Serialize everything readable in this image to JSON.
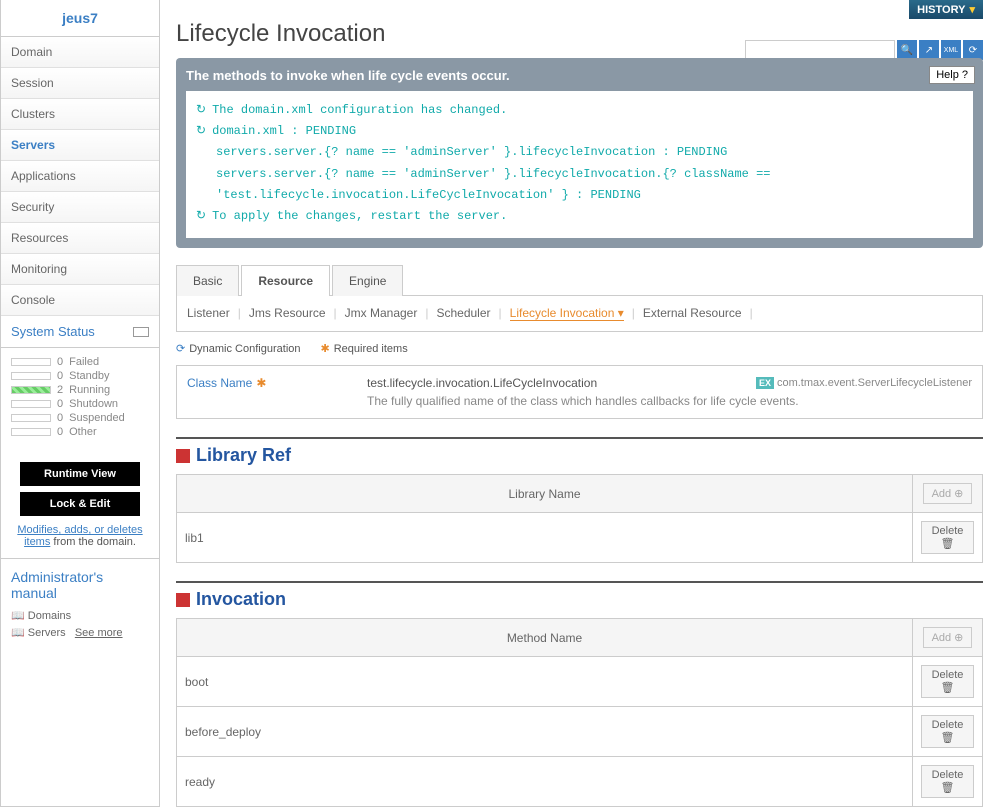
{
  "brand": "jeus7",
  "nav": [
    "Domain",
    "Session",
    "Clusters",
    "Servers",
    "Applications",
    "Security",
    "Resources",
    "Monitoring",
    "Console"
  ],
  "nav_active": 3,
  "status_header": "System Status",
  "statuses": [
    {
      "count": "0",
      "label": "Failed",
      "green": false
    },
    {
      "count": "0",
      "label": "Standby",
      "green": false
    },
    {
      "count": "2",
      "label": "Running",
      "green": true
    },
    {
      "count": "0",
      "label": "Shutdown",
      "green": false
    },
    {
      "count": "0",
      "label": "Suspended",
      "green": false
    },
    {
      "count": "0",
      "label": "Other",
      "green": false
    }
  ],
  "buttons": {
    "runtime": "Runtime View",
    "lock": "Lock & Edit"
  },
  "edit_link": "Modifies, adds, or deletes items",
  "edit_text": " from the domain.",
  "manual": {
    "title": "Administrator's manual",
    "items": [
      "Domains",
      "Servers"
    ],
    "more": "See more"
  },
  "history": "HISTORY",
  "page_title": "Lifecycle Invocation",
  "info": {
    "title": "The methods to invoke when life cycle events occur.",
    "help": "Help",
    "lines": [
      "The domain.xml configuration has changed.",
      "domain.xml : PENDING",
      "servers.server.{? name == 'adminServer' }.lifecycleInvocation : PENDING",
      "servers.server.{? name == 'adminServer' }.lifecycleInvocation.{? className ==",
      "'test.lifecycle.invocation.LifeCycleInvocation' } : PENDING",
      "To apply the changes, restart the server."
    ]
  },
  "tabs": [
    "Basic",
    "Resource",
    "Engine"
  ],
  "tab_active": 1,
  "sub_tabs": [
    "Listener",
    "Jms Resource",
    "Jmx Manager",
    "Scheduler",
    "Lifecycle Invocation",
    "External Resource"
  ],
  "sub_active": 4,
  "legend": {
    "dyn": "Dynamic Configuration",
    "req": "Required items"
  },
  "config": {
    "label": "Class Name",
    "value": "test.lifecycle.invocation.LifeCycleInvocation",
    "example": "com.tmax.event.ServerLifecycleListener",
    "desc": "The fully qualified name of the class which handles callbacks for life cycle events."
  },
  "sections": {
    "library": {
      "title": "Library Ref",
      "col": "Library Name",
      "rows": [
        "lib1"
      ]
    },
    "invocation": {
      "title": "Invocation",
      "col": "Method Name",
      "rows": [
        "boot",
        "before_deploy",
        "ready"
      ]
    }
  },
  "btn_labels": {
    "add": "Add",
    "delete": "Delete",
    "ex": "EX"
  }
}
